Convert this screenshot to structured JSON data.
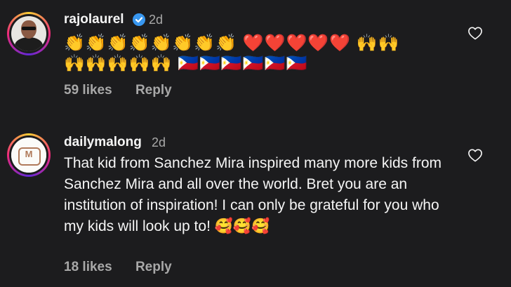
{
  "comments": [
    {
      "username": "rajolaurel",
      "verified": true,
      "time": "2d",
      "emoji_line_1": "👏👏👏👏👏👏👏👏 ❤️❤️❤️❤️❤️ 🙌🙌",
      "emoji_line_2": "🙌🙌🙌🙌🙌 🇵🇭🇵🇭🇵🇭🇵🇭🇵🇭🇵🇭",
      "likes": "59 likes",
      "reply": "Reply",
      "icons": {
        "like": "heart-outline-icon",
        "verified": "verified-badge-icon"
      }
    },
    {
      "username": "dailymalong",
      "verified": false,
      "time": "2d",
      "text": "That kid from Sanchez Mira inspired many more kids from Sanchez Mira and all over the world. Bret you are an institution of inspiration!  I can only be grateful for you who my kids will look up to! 🥰🥰🥰",
      "likes": "18 likes",
      "reply": "Reply",
      "icons": {
        "like": "heart-outline-icon"
      }
    }
  ],
  "colors": {
    "background": "#1c1c1e",
    "primary_text": "#f5f5f5",
    "secondary_text": "#a8a8a8",
    "verified": "#3897f0"
  }
}
